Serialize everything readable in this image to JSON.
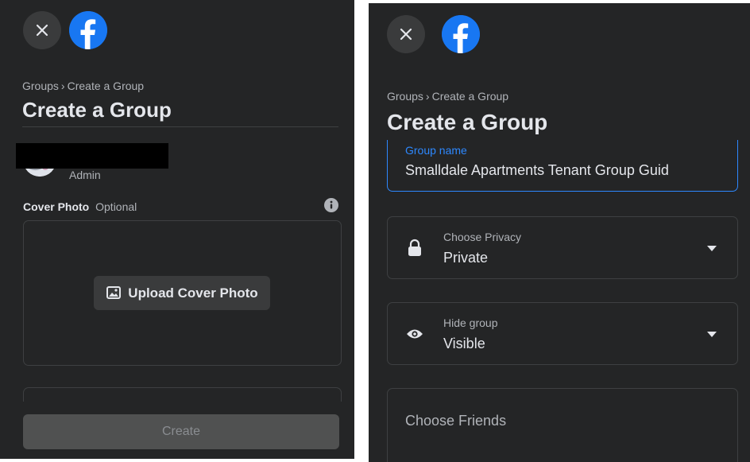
{
  "breadcrumb": {
    "parent": "Groups",
    "separator": "›",
    "current": "Create a Group"
  },
  "page_title": "Create a Group",
  "admin": {
    "role": "Admin"
  },
  "cover_photo": {
    "label": "Cover Photo",
    "optional": "Optional",
    "upload_label": "Upload Cover Photo"
  },
  "create_button_label": "Create",
  "group_name": {
    "label": "Group name",
    "value": "Smalldale Apartments Tenant Group Guid"
  },
  "privacy": {
    "label": "Choose Privacy",
    "value": "Private"
  },
  "visibility": {
    "label": "Hide group",
    "value": "Visible"
  },
  "friends": {
    "label": "Choose Friends"
  },
  "icons": [
    "close-icon",
    "facebook-logo-icon",
    "info-icon",
    "image-icon",
    "lock-icon",
    "eye-icon",
    "caret-down-icon"
  ],
  "colors": {
    "panel_bg": "#242526",
    "accent": "#1877f2",
    "text": "#e4e6eb",
    "muted": "#b0b3b8"
  }
}
